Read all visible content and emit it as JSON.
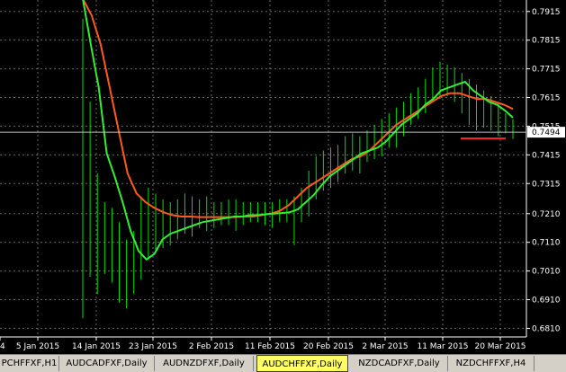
{
  "chart_data": {
    "type": "candlestick",
    "y_ticks": [
      "0.7915",
      "0.7815",
      "0.7715",
      "0.7615",
      "0.7515",
      "0.7415",
      "0.7315",
      "0.7210",
      "0.7110",
      "0.7010",
      "0.6910",
      "0.6810"
    ],
    "x_ticks": [
      "4",
      "5 Jan 2015",
      "14 Jan 2015",
      "23 Jan 2015",
      "2 Feb 2015",
      "11 Feb 2015",
      "20 Feb 2015",
      "2 Mar 2015",
      "11 Mar 2015",
      "20 Mar 2015"
    ],
    "current_price": "0.7494",
    "ylim": [
      0.678,
      0.7955
    ],
    "colors": {
      "background": "#000000",
      "grid": "#c0c0c0",
      "bars": "#00e000",
      "fast_ma": "#33ee33",
      "slow_ma": "#ff5a1f",
      "level_line": "#ff2020",
      "price_label_bg": "#ffffff"
    },
    "bars": [
      [
        0.789,
        0.6845
      ],
      [
        0.76,
        0.699
      ],
      [
        0.735,
        0.693
      ],
      [
        0.725,
        0.7
      ],
      [
        0.723,
        0.697
      ],
      [
        0.718,
        0.69
      ],
      [
        0.712,
        0.688
      ],
      [
        0.715,
        0.693
      ],
      [
        0.727,
        0.698
      ],
      [
        0.73,
        0.705
      ],
      [
        0.728,
        0.708
      ],
      [
        0.726,
        0.709
      ],
      [
        0.725,
        0.71
      ],
      [
        0.726,
        0.712
      ],
      [
        0.728,
        0.714
      ],
      [
        0.727,
        0.713
      ],
      [
        0.726,
        0.716
      ],
      [
        0.727,
        0.715
      ],
      [
        0.725,
        0.716
      ],
      [
        0.725,
        0.717
      ],
      [
        0.726,
        0.717
      ],
      [
        0.726,
        0.715
      ],
      [
        0.725,
        0.717
      ],
      [
        0.725,
        0.718
      ],
      [
        0.725,
        0.718
      ],
      [
        0.725,
        0.717
      ],
      [
        0.725,
        0.716
      ],
      [
        0.726,
        0.718
      ],
      [
        0.726,
        0.718
      ],
      [
        0.727,
        0.71
      ],
      [
        0.73,
        0.718
      ],
      [
        0.736,
        0.72
      ],
      [
        0.741,
        0.726
      ],
      [
        0.743,
        0.729
      ],
      [
        0.744,
        0.73
      ],
      [
        0.745,
        0.732
      ],
      [
        0.748,
        0.735
      ],
      [
        0.749,
        0.736
      ],
      [
        0.748,
        0.735
      ],
      [
        0.75,
        0.739
      ],
      [
        0.752,
        0.74
      ],
      [
        0.754,
        0.741
      ],
      [
        0.756,
        0.744
      ],
      [
        0.758,
        0.744
      ],
      [
        0.76,
        0.748
      ],
      [
        0.763,
        0.752
      ],
      [
        0.765,
        0.754
      ],
      [
        0.768,
        0.756
      ],
      [
        0.772,
        0.76
      ],
      [
        0.774,
        0.761
      ],
      [
        0.773,
        0.762
      ],
      [
        0.772,
        0.76
      ],
      [
        0.77,
        0.756
      ],
      [
        0.768,
        0.752
      ],
      [
        0.766,
        0.75
      ],
      [
        0.764,
        0.751
      ],
      [
        0.762,
        0.75
      ],
      [
        0.76,
        0.748
      ],
      [
        0.756,
        0.749
      ],
      [
        0.754,
        0.747
      ]
    ],
    "fast_ma": [
      0.796,
      0.78,
      0.765,
      0.742,
      0.734,
      0.725,
      0.715,
      0.708,
      0.705,
      0.707,
      0.712,
      0.714,
      0.715,
      0.716,
      0.717,
      0.718,
      0.7185,
      0.719,
      0.7195,
      0.72,
      0.72,
      0.7205,
      0.7205,
      0.7208,
      0.721,
      0.7212,
      0.7215,
      0.7225,
      0.725,
      0.7275,
      0.731,
      0.734,
      0.736,
      0.738,
      0.74,
      0.742,
      0.743,
      0.744,
      0.746,
      0.749,
      0.752,
      0.754,
      0.756,
      0.759,
      0.761,
      0.764,
      0.765,
      0.766,
      0.767,
      0.764,
      0.762,
      0.76,
      0.759,
      0.757,
      0.7545
    ],
    "slow_ma": [
      0.796,
      0.79,
      0.78,
      0.765,
      0.75,
      0.735,
      0.728,
      0.725,
      0.723,
      0.7215,
      0.7205,
      0.72,
      0.72,
      0.7198,
      0.7198,
      0.7198,
      0.7198,
      0.7198,
      0.72,
      0.72,
      0.7205,
      0.721,
      0.722,
      0.724,
      0.727,
      0.73,
      0.732,
      0.734,
      0.736,
      0.738,
      0.74,
      0.741,
      0.743,
      0.746,
      0.749,
      0.752,
      0.754,
      0.756,
      0.758,
      0.76,
      0.762,
      0.763,
      0.763,
      0.762,
      0.761,
      0.761,
      0.76,
      0.759,
      0.7575
    ],
    "level_line": 0.7485
  },
  "tabs": [
    {
      "label": "PCHFFXF,H1"
    },
    {
      "label": "AUDCADFXF,Daily"
    },
    {
      "label": "AUDNZDFXF,Daily"
    },
    {
      "label": "AUDCHFFXF,Daily"
    },
    {
      "label": "NZDCADFXF,Daily"
    },
    {
      "label": "NZDCHFFXF,H4"
    }
  ]
}
